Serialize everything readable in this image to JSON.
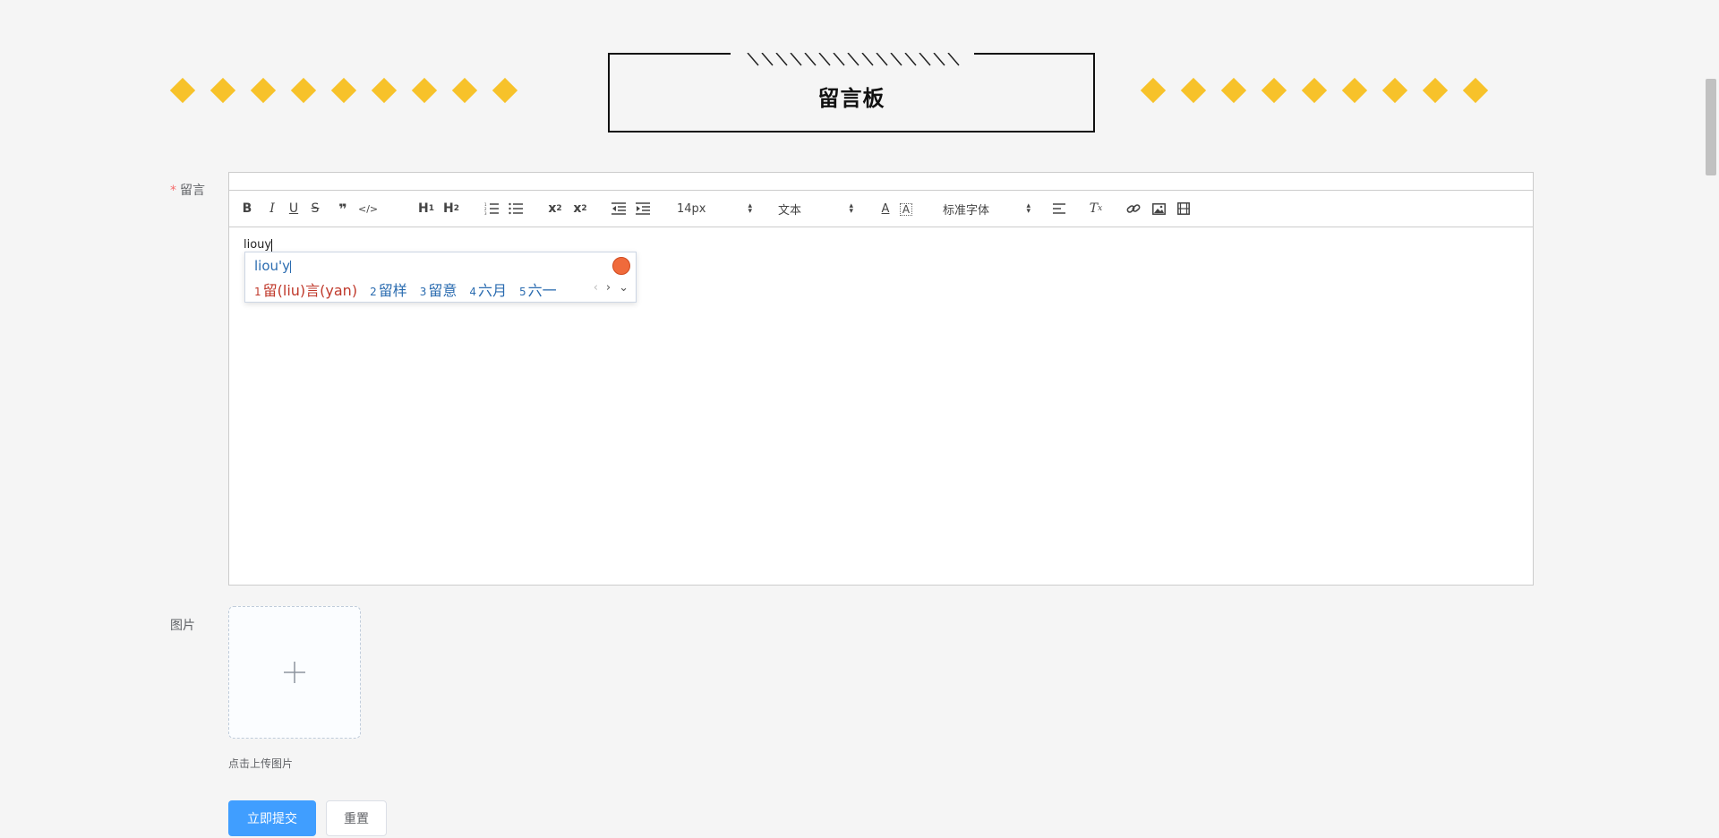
{
  "header": {
    "title": "留言板"
  },
  "form": {
    "message_label": "留言",
    "required_mark": "*",
    "image_label": "图片",
    "upload_tip": "点击上传图片",
    "submit_label": "立即提交",
    "reset_label": "重置"
  },
  "toolbar": {
    "size_picker": "14px",
    "header_picker": "文本",
    "font_picker": "标准字体"
  },
  "editor": {
    "content": "liouy"
  },
  "ime": {
    "input": "liou'y",
    "candidates": [
      {
        "num": "1",
        "text": "留(liu)言(yan)"
      },
      {
        "num": "2",
        "text": "留样"
      },
      {
        "num": "3",
        "text": "留意"
      },
      {
        "num": "4",
        "text": "六月"
      },
      {
        "num": "5",
        "text": "六一"
      }
    ],
    "nav": {
      "prev": "‹",
      "next": "›",
      "expand": "⌄"
    }
  },
  "colors": {
    "accent": "#f7c22a",
    "primary": "#409eff",
    "required": "#f56c6c"
  },
  "icons": [
    "bold-icon",
    "italic-icon",
    "underline-icon",
    "strike-icon",
    "blockquote-icon",
    "code-icon",
    "h1-icon",
    "h2-icon",
    "ordered-list-icon",
    "bullet-list-icon",
    "subscript-icon",
    "superscript-icon",
    "outdent-icon",
    "indent-icon",
    "font-color-icon",
    "background-color-icon",
    "align-icon",
    "clear-format-icon",
    "link-icon",
    "image-icon",
    "video-icon",
    "plus-icon"
  ]
}
